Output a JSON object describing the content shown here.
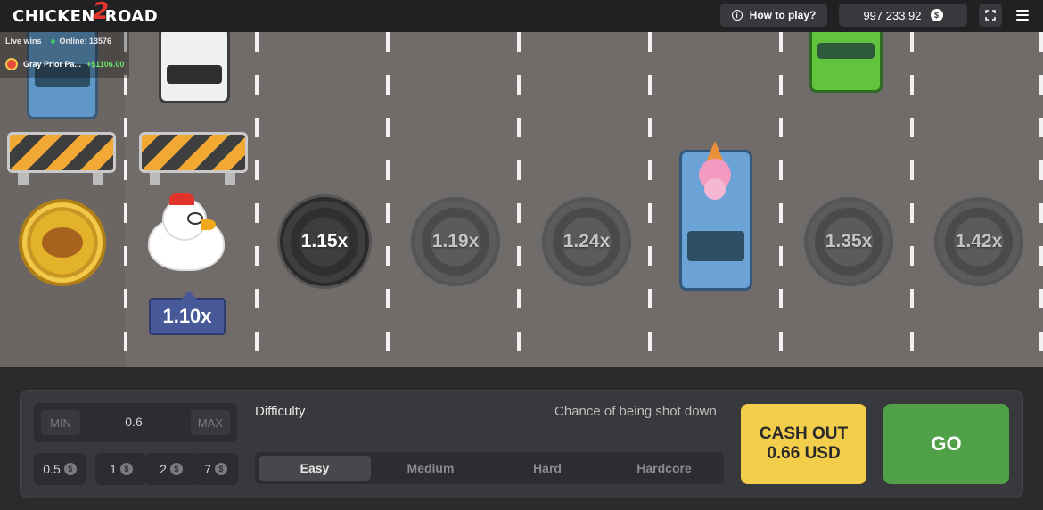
{
  "header": {
    "logo_left": "CHICKEN",
    "logo_num": "2",
    "logo_right": "ROAD",
    "how_to_play": "How to play?",
    "balance": "997 233.92",
    "currency_icon": "dollar-coin-icon"
  },
  "live": {
    "label": "Live wins",
    "online": "Online: 13576",
    "winner_name": "Gray Prior Pa...",
    "winner_amount": "+$1106.00"
  },
  "road": {
    "current_multiplier": "1.10x",
    "multipliers": [
      "1.15x",
      "1.19x",
      "1.24x",
      "1.35x",
      "1.42x"
    ]
  },
  "controls": {
    "min_label": "MIN",
    "max_label": "MAX",
    "bet_value": "0.6",
    "quick_bets": [
      "0.5",
      "1",
      "2",
      "7"
    ],
    "difficulty_label": "Difficulty",
    "chance_label": "Chance of being shot down",
    "difficulties": [
      "Easy",
      "Medium",
      "Hard",
      "Hardcore"
    ],
    "active_difficulty": "Easy",
    "cashout_line1": "CASH OUT",
    "cashout_line2": "0.66 USD",
    "go_label": "GO"
  },
  "colors": {
    "cashout": "#f3ce4b",
    "go": "#4fa046",
    "road": "#716c69"
  }
}
